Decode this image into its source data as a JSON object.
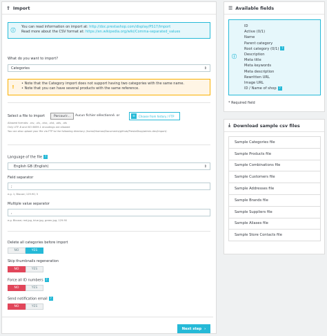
{
  "import_panel": {
    "title": "Import",
    "info": {
      "line1": "You can read information on import at:",
      "line1_link": "http://doc.prestashop.com/display/PS17/Import",
      "line2": "Read more about the CSV format at:",
      "line2_link": "https://en.wikipedia.org/wiki/Comma-separated_values"
    },
    "what_label": "What do you want to import?",
    "what_value": "Categories",
    "warnings": [
      "Note that the Category import does not support having two categories with the same name.",
      "Note that you can have several products with the same reference."
    ],
    "file_label": "Select a file to import",
    "browse_label": "Parcourir...",
    "no_file": "Aucun fichier sélectionné.",
    "or": "or",
    "choose_history": "Choose from history / FTP",
    "hint1": "Allowed formats: .csv, .xls, .xlsx, .xlst, .ods, .ots",
    "hint2": "Only UTF-8 and ISO 8859-1 encodings are allowed",
    "hint3": "You can also upload your file via FTP to the following directory: /home/thomas/Documents/github/PrestaShop/admin-dev/import/.",
    "language_label": "Language of the file",
    "language_value": "English GB (English)",
    "field_sep_label": "Field separator",
    "field_sep_value": ";",
    "field_sep_hint": "e.g. 1; Blouse; 129.90; 5",
    "multi_sep_label": "Multiple value separator",
    "multi_sep_value": ",",
    "multi_sep_hint": "e.g. Blouse; red.jpg, blue.jpg, green.jpg; 129.90",
    "options": [
      {
        "label": "Delete all categories before import",
        "no": "NO",
        "yes": "YES",
        "selected": "yes",
        "help": false
      },
      {
        "label": "Skip thumbnails regeneration",
        "no": "NO",
        "yes": "YES",
        "selected": "no",
        "help": false
      },
      {
        "label": "Force all ID numbers",
        "no": "NO",
        "yes": "YES",
        "selected": "no",
        "help": true
      },
      {
        "label": "Send notification email",
        "no": "NO",
        "yes": "YES",
        "selected": "no",
        "help": true
      }
    ],
    "next_label": "Next step",
    "help_mark": "?"
  },
  "fields_panel": {
    "title": "Available fields",
    "fields": [
      "ID",
      "Active (0/1)",
      "Name",
      "Parent category",
      "Root category (0/1)",
      "Description",
      "Meta title",
      "Meta keywords",
      "Meta description",
      "Rewritten URL",
      "Image URL",
      "ID / Name of shop"
    ],
    "help_after": [
      4,
      11
    ],
    "required_note": "* Required field"
  },
  "samples_panel": {
    "title": "Download sample csv files",
    "files": [
      "Sample Categories file",
      "Sample Products file",
      "Sample Combinations file",
      "Sample Customers file",
      "Sample Addresses file",
      "Sample Brands file",
      "Sample Suppliers file",
      "Sample Aliases file",
      "Sample Store Contacts file"
    ]
  },
  "colors": {
    "primary": "#25b9d7",
    "danger": "#e1465a",
    "warning": "#fab000"
  },
  "icons": [
    "upload-icon",
    "info-icon",
    "warning-icon",
    "list-icon",
    "download-icon",
    "help-icon",
    "chevron-down-icon",
    "chevron-right-icon"
  ]
}
